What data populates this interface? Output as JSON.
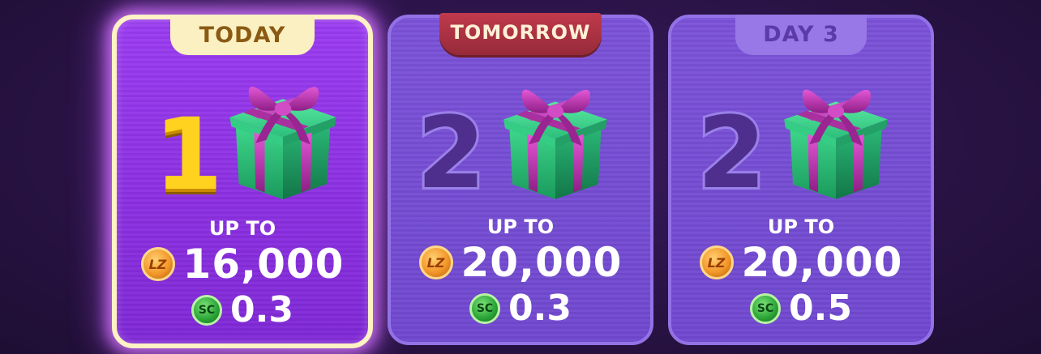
{
  "cards": [
    {
      "tab": "TODAY",
      "day_number": "1",
      "up_to": "UP TO",
      "coins": "16,000",
      "coin_icon": "LZ",
      "sc": "0.3",
      "sc_icon": "SC"
    },
    {
      "tab": "TOMORROW",
      "day_number": "2",
      "up_to": "UP TO",
      "coins": "20,000",
      "coin_icon": "LZ",
      "sc": "0.3",
      "sc_icon": "SC"
    },
    {
      "tab": "DAY 3",
      "day_number": "2",
      "up_to": "UP TO",
      "coins": "20,000",
      "coin_icon": "LZ",
      "sc": "0.5",
      "sc_icon": "SC"
    }
  ],
  "colors": {
    "today_highlight": "#fff2c4",
    "today_number": "#ffd21f",
    "tomorrow_tab": "#c03a4c",
    "gift_box": "#2fc07a",
    "gift_ribbon": "#b32aa8"
  }
}
